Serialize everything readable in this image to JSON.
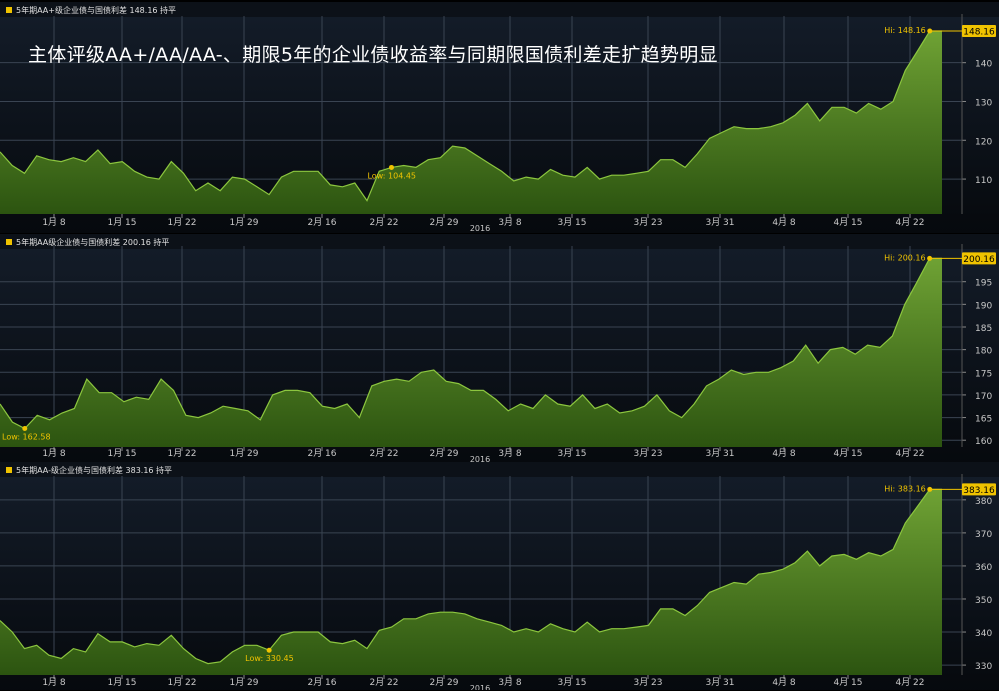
{
  "headline": "主体评级AA+/AA/AA-、期限5年的企业债收益率与同期限国债利差走扩趋势明显",
  "year_label": "2016",
  "colors": {
    "area_top": "#6fa234",
    "area_bottom": "#2c5410",
    "line": "#8cc63f",
    "grid": "#3a4452",
    "tick_text": "#c8c8c8",
    "marker": "#f0c300"
  },
  "chart_data": [
    {
      "type": "area",
      "legend": "5年期AA+级企业债与国债利差 148.16 持平",
      "hi_label": "Hi: 148.16",
      "low_label": "Low: 104.45",
      "last_label": "148.16",
      "xticks": [
        "1月 8",
        "1月 15",
        "1月 22",
        "1月 29",
        "2月 16",
        "2月 22",
        "2月 29",
        "3月 8",
        "3月 15",
        "3月 23",
        "3月 31",
        "4月 8",
        "4月 15",
        "4月 22"
      ],
      "yticks": [
        110,
        120,
        130,
        140
      ],
      "ylim": [
        101,
        151
      ],
      "low_index": 32,
      "values": [
        117,
        113.5,
        111.5,
        116,
        115,
        114.5,
        115.5,
        114.5,
        117.5,
        114,
        114.5,
        112,
        110.5,
        110,
        114.5,
        111.5,
        107,
        109,
        107,
        110.5,
        110,
        108,
        106,
        110.5,
        112,
        112,
        112,
        108.5,
        108,
        109,
        104.45,
        112,
        113,
        113.5,
        113,
        115,
        115.5,
        118.5,
        118,
        116,
        114,
        112,
        109.5,
        110.5,
        110,
        112.5,
        111,
        110.5,
        113,
        110,
        111,
        111,
        111.5,
        112,
        115,
        115,
        113,
        116.5,
        120.5,
        122,
        123.5,
        123,
        123,
        123.5,
        124.5,
        126.5,
        129.5,
        125,
        128.5,
        128.5,
        127,
        129.5,
        128,
        130,
        138,
        143,
        148.16,
        148.16
      ]
    },
    {
      "type": "area",
      "legend": "5年期AA级企业债与国债利差 200.16 持平",
      "hi_label": "Hi: 200.16",
      "low_label": "Low: 162.58",
      "last_label": "200.16",
      "xticks": [
        "1月 8",
        "1月 15",
        "1月 22",
        "1月 29",
        "2月 16",
        "2月 22",
        "2月 29",
        "3月 8",
        "3月 15",
        "3月 23",
        "3月 31",
        "4月 8",
        "4月 15",
        "4月 22"
      ],
      "yticks": [
        160,
        165,
        170,
        175,
        180,
        185,
        190,
        195
      ],
      "ylim": [
        158.5,
        202
      ],
      "low_index": 2,
      "values": [
        168,
        164,
        162.58,
        165.5,
        164.5,
        166,
        167,
        173.5,
        170.5,
        170.5,
        168.5,
        169.5,
        169,
        173.5,
        171,
        165.5,
        165,
        166,
        167.5,
        167,
        166.5,
        164.5,
        170,
        171,
        171,
        170.5,
        167.5,
        167,
        168,
        165,
        172,
        173,
        173.5,
        173,
        175,
        175.5,
        173,
        172.5,
        171,
        171,
        169,
        166.5,
        168,
        167,
        170,
        168,
        167.5,
        170,
        167,
        168,
        166,
        166.5,
        167.5,
        170,
        166.5,
        165,
        168,
        172,
        173.5,
        175.5,
        174.5,
        175,
        175,
        176,
        177.5,
        181,
        177,
        180,
        180.5,
        179,
        181,
        180.5,
        183,
        190,
        195,
        200.16,
        200.16
      ]
    },
    {
      "type": "area",
      "legend": "5年期AA-级企业债与国债利差 383.16 持平",
      "hi_label": "Hi: 383.16",
      "low_label": "Low: 330.45",
      "last_label": "383.16",
      "xticks": [
        "1月 8",
        "1月 15",
        "1月 22",
        "1月 29",
        "2月 16",
        "2月 22",
        "2月 29",
        "3月 8",
        "3月 15",
        "3月 23",
        "3月 31",
        "4月 8",
        "4月 15",
        "4月 22"
      ],
      "yticks": [
        330,
        340,
        350,
        360,
        370,
        380
      ],
      "ylim": [
        327,
        386
      ],
      "low_index": 22,
      "values": [
        343.5,
        340,
        335,
        336,
        333,
        332,
        335,
        334,
        339.5,
        337,
        337,
        335.5,
        336.5,
        336,
        339,
        335,
        332,
        330.45,
        331,
        334,
        336,
        336,
        334.5,
        339,
        340,
        340,
        340,
        337,
        336.5,
        337.5,
        335,
        340.5,
        341.5,
        344,
        344,
        345.5,
        346,
        346,
        345.5,
        344,
        343,
        342,
        340,
        341,
        340,
        342.5,
        341,
        340,
        343,
        340,
        341,
        341,
        341.5,
        342,
        347,
        347,
        345,
        348,
        352,
        353.5,
        355,
        354.5,
        357.5,
        358,
        359,
        361,
        364.5,
        360,
        363,
        363.5,
        362,
        364,
        363,
        365,
        373,
        378,
        383.16,
        383.16
      ]
    }
  ]
}
